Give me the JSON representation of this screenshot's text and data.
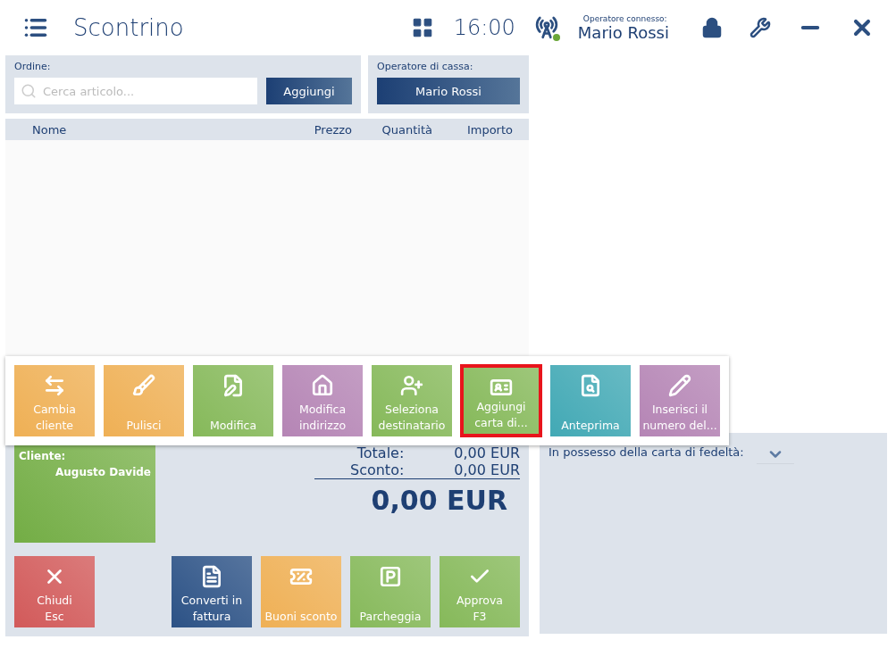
{
  "header": {
    "title": "Scontrino",
    "time": "16:00",
    "operator_label": "Operatore connesso:",
    "operator": "Mario Rossi",
    "connected": true
  },
  "order": {
    "label": "Ordine:",
    "placeholder": "Cerca articolo...",
    "button": "Aggiungi"
  },
  "cashier": {
    "label": "Operatore di cassa:",
    "button": "Mario Rossi"
  },
  "table": {
    "columns": [
      "Nome",
      "Prezzo",
      "Quantità",
      "Importo"
    ]
  },
  "actions": [
    {
      "lines": [
        "Cambia",
        "cliente"
      ],
      "color": "#efb055",
      "selected": false
    },
    {
      "lines": [
        "Pulisci"
      ],
      "color": "#efb055",
      "selected": false
    },
    {
      "lines": [
        "Modifica"
      ],
      "color": "#86b95a",
      "selected": false
    },
    {
      "lines": [
        "Modifica",
        "indirizzo"
      ],
      "color": "#b585b5",
      "selected": false
    },
    {
      "lines": [
        "Seleziona",
        "destinatario"
      ],
      "color": "#86b95a",
      "selected": false
    },
    {
      "lines": [
        "Aggiungi",
        "carta di..."
      ],
      "color": "#86b95a",
      "selected": true
    },
    {
      "lines": [
        "Anteprima"
      ],
      "color": "#42a9b5",
      "selected": false
    },
    {
      "lines": [
        "Inserisci il",
        "numero del..."
      ],
      "color": "#b585b5",
      "selected": false
    }
  ],
  "customer": {
    "label": "Cliente:",
    "name": "Augusto Davide"
  },
  "totals": {
    "total_label": "Totale:",
    "total": "0,00 EUR",
    "discount_label": "Sconto:",
    "discount": "0,00 EUR",
    "grand_total": "0,00 EUR"
  },
  "buttons": [
    {
      "lines": [
        "Chiudi",
        "Esc"
      ],
      "color": "#d25a5a"
    },
    {
      "lines": [
        "Converti in",
        "fattura"
      ],
      "color": "#2c5286"
    },
    {
      "lines": [
        "Buoni sconto"
      ],
      "color": "#efb055"
    },
    {
      "lines": [
        "Parcheggia"
      ],
      "color": "#86b95a"
    },
    {
      "lines": [
        "Approva",
        "F3"
      ],
      "color": "#86b95a"
    }
  ],
  "loyalty": {
    "label": "In possesso della carta di fedeltà:"
  }
}
